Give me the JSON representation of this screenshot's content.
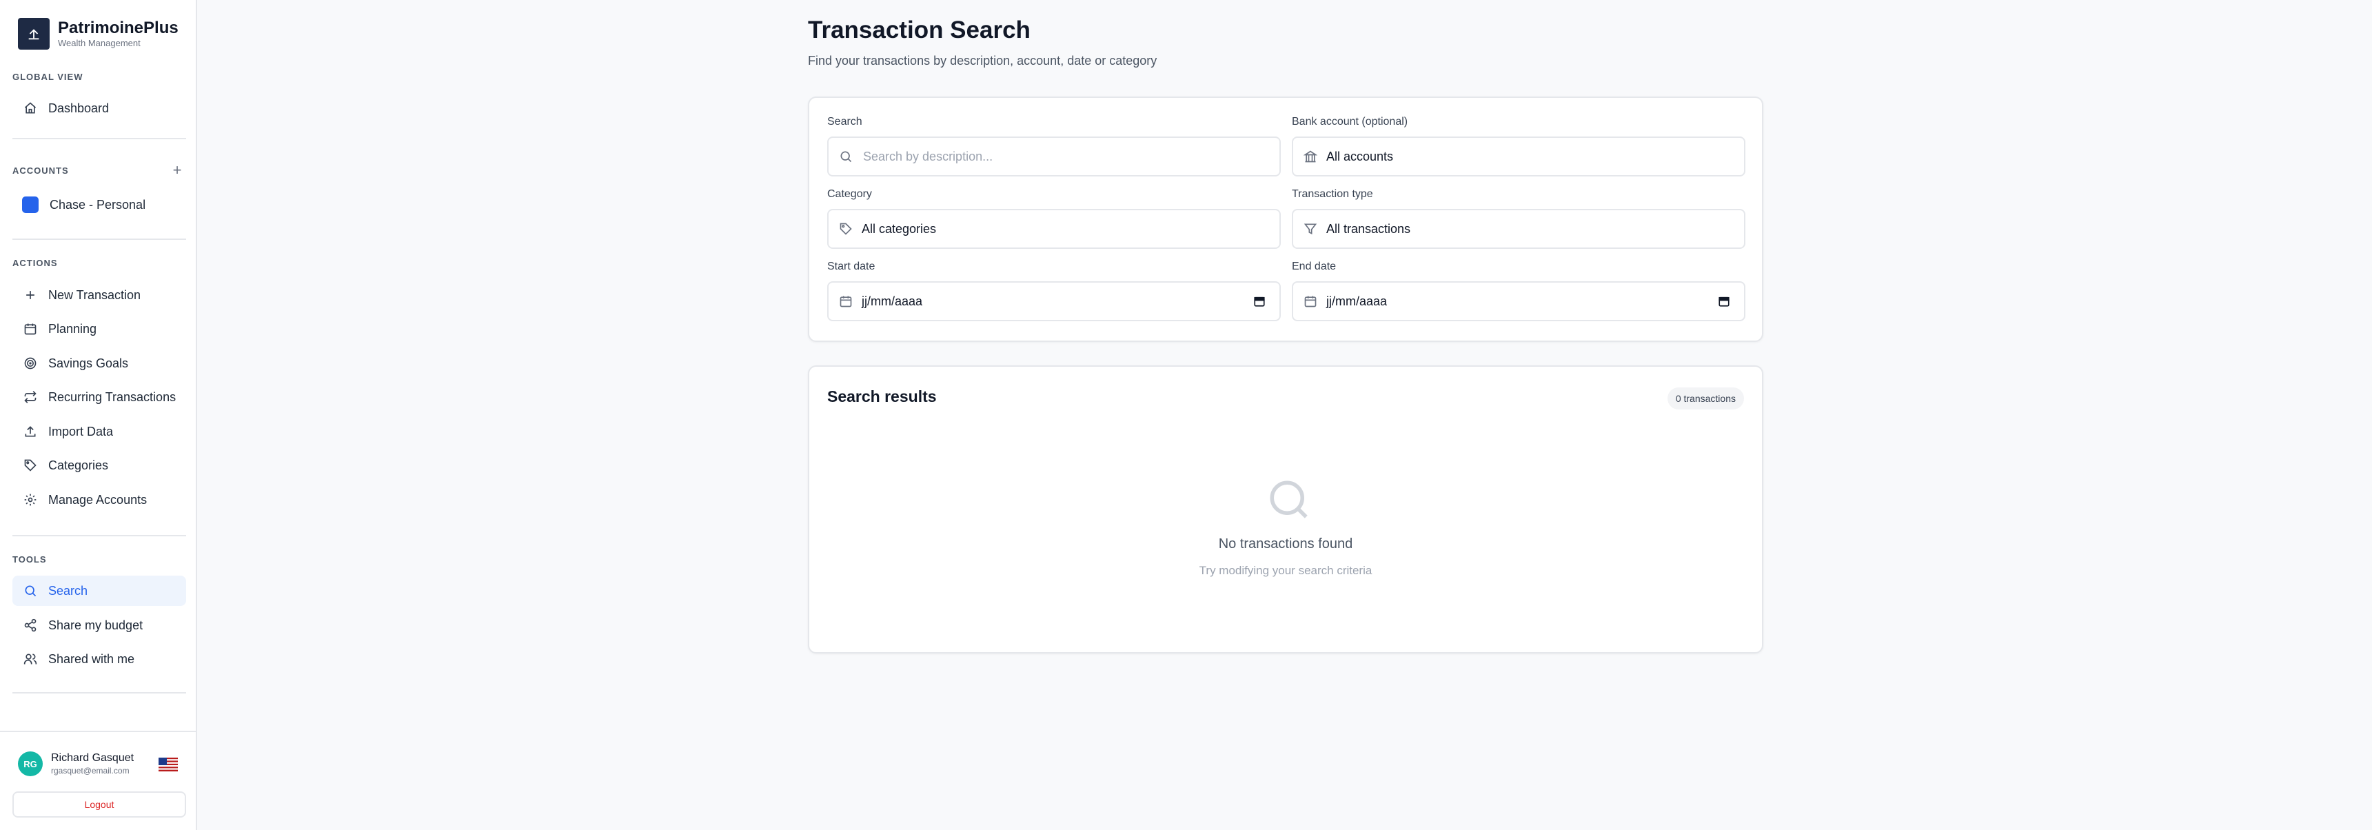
{
  "brand": {
    "name": "PatrimoinePlus",
    "subtitle": "Wealth Management"
  },
  "sidebar": {
    "global_view_label": "GLOBAL VIEW",
    "dashboard": {
      "label": "Dashboard",
      "icon": "home-icon"
    },
    "accounts_label": "ACCOUNTS",
    "accounts": [
      {
        "label": "Chase - Personal",
        "color": "#2563eb"
      }
    ],
    "actions_label": "ACTIONS",
    "actions": [
      {
        "label": "New Transaction",
        "icon": "plus-icon"
      },
      {
        "label": "Planning",
        "icon": "calendar-icon"
      },
      {
        "label": "Savings Goals",
        "icon": "target-icon"
      },
      {
        "label": "Recurring Transactions",
        "icon": "repeat-icon"
      },
      {
        "label": "Import Data",
        "icon": "upload-icon"
      },
      {
        "label": "Categories",
        "icon": "tag-icon"
      },
      {
        "label": "Manage Accounts",
        "icon": "gear-icon"
      }
    ],
    "tools_label": "TOOLS",
    "tools": [
      {
        "label": "Search",
        "icon": "search-icon",
        "active": true
      },
      {
        "label": "Share my budget",
        "icon": "share-icon"
      },
      {
        "label": "Shared with me",
        "icon": "users-icon"
      }
    ]
  },
  "user": {
    "initials": "RG",
    "name": "Richard Gasquet",
    "email": "rgasquet@email.com",
    "avatar_color": "#14b8a6",
    "logout_label": "Logout"
  },
  "page": {
    "title": "Transaction Search",
    "subtitle": "Find your transactions by description, account, date or category"
  },
  "filters": {
    "search_label": "Search",
    "search_placeholder": "Search by description...",
    "account_label": "Bank account (optional)",
    "account_value": "All accounts",
    "category_label": "Category",
    "category_value": "All categories",
    "type_label": "Transaction type",
    "type_value": "All transactions",
    "start_label": "Start date",
    "start_value": "jj/mm/aaaa",
    "end_label": "End date",
    "end_value": "jj/mm/aaaa"
  },
  "results": {
    "title": "Search results",
    "count": "0 transactions",
    "empty_title": "No transactions found",
    "empty_sub": "Try modifying your search criteria"
  },
  "colors": {
    "accent": "#2563eb",
    "logout": "#dc2626",
    "sidebar_active_bg": "#eef4fd"
  }
}
